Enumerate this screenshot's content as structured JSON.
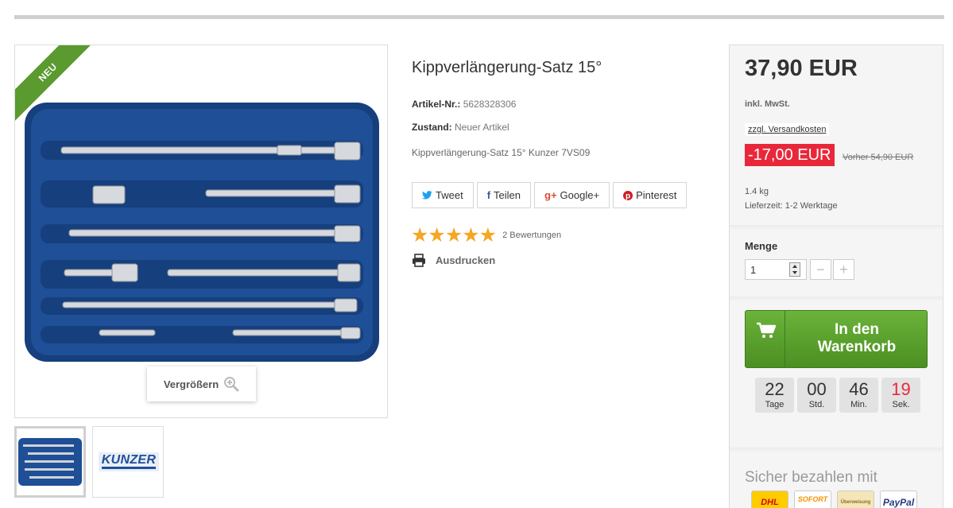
{
  "product": {
    "badge": "NEU",
    "title": "Kippverlängerung-Satz 15°",
    "article_label": "Artikel-Nr.:",
    "article_number": "5628328306",
    "condition_label": "Zustand:",
    "condition_value": "Neuer Artikel",
    "description": "Kippverlängerung-Satz 15° Kunzer 7VS09",
    "zoom_label": "Vergrößern",
    "thumb_brand": "KUNZER"
  },
  "share": {
    "tweet": "Tweet",
    "facebook": "Teilen",
    "googleplus": "Google+",
    "pinterest": "Pinterest"
  },
  "rating": {
    "stars": 5,
    "stars_text": "★★★★★",
    "reviews_text": "2 Bewertungen"
  },
  "print_label": "Ausdrucken",
  "buybox": {
    "price": "37,90 EUR",
    "tax_note": "inkl. MwSt.",
    "shipping_link": "zzgl. Versandkosten",
    "discount": "-17,00 EUR",
    "old_price": "Vorher 54,90 EUR",
    "weight": "1.4 kg",
    "delivery": "Lieferzeit: 1-2 Werktage",
    "quantity_label": "Menge",
    "quantity_value": "1",
    "cart_line1": "In den",
    "cart_line2": "Warenkorb",
    "pay_label": "Sicher bezahlen mit"
  },
  "countdown": [
    {
      "value": "22",
      "unit": "Tage"
    },
    {
      "value": "00",
      "unit": "Std."
    },
    {
      "value": "46",
      "unit": "Min."
    },
    {
      "value": "19",
      "unit": "Sek."
    }
  ],
  "payment_methods": [
    {
      "name": "DHL",
      "color": "#ffcc00"
    },
    {
      "name": "SOFORT",
      "color": "#f39200"
    },
    {
      "name": "Überweisung",
      "color": "#f5e6b8"
    },
    {
      "name": "PayPal",
      "color": "#253b80"
    }
  ],
  "colors": {
    "accent_green": "#5a9a2e",
    "discount_red": "#e8283a",
    "star_orange": "#f5a623",
    "case_blue": "#1f4f96"
  }
}
